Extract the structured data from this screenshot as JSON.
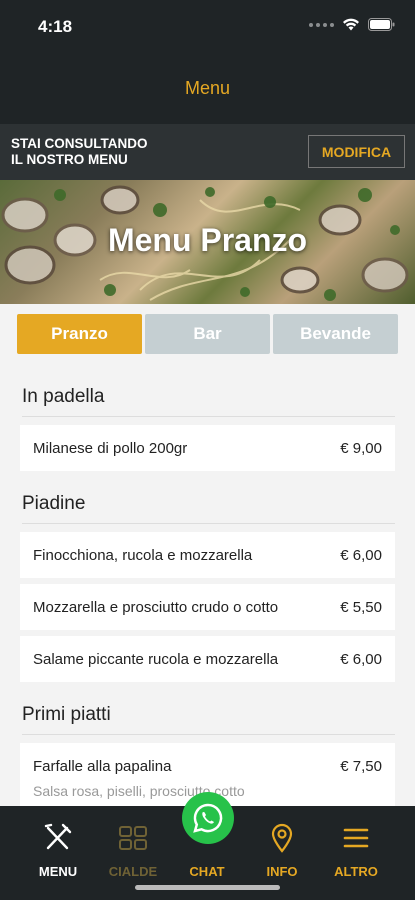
{
  "status": {
    "time": "4:18"
  },
  "nav": {
    "title": "Menu"
  },
  "banner": {
    "line1": "STAI CONSULTANDO",
    "line2": "IL NOSTRO MENU",
    "modify_label": "MODIFICA"
  },
  "hero": {
    "title": "Menu Pranzo"
  },
  "tabs": [
    {
      "label": "Pranzo",
      "active": true
    },
    {
      "label": "Bar",
      "active": false
    },
    {
      "label": "Bevande",
      "active": false
    }
  ],
  "sections": [
    {
      "title": "In padella",
      "items": [
        {
          "name": "Milanese di pollo 200gr",
          "price": "€ 9,00"
        }
      ]
    },
    {
      "title": "Piadine",
      "items": [
        {
          "name": "Finocchiona, rucola e mozzarella",
          "price": "€ 6,00"
        },
        {
          "name": "Mozzarella e prosciutto crudo o cotto",
          "price": "€ 5,50"
        },
        {
          "name": "Salame piccante rucola e mozzarella",
          "price": "€ 6,00"
        }
      ]
    },
    {
      "title": "Primi piatti",
      "items": [
        {
          "name": "Farfalle alla papalina",
          "desc": "Salsa rosa, piselli, prosciutto cotto",
          "price": "€ 7,50"
        }
      ]
    }
  ],
  "tabbar": {
    "menu": "MENU",
    "cialde": "CIALDE",
    "chat": "CHAT",
    "info": "INFO",
    "altro": "ALTRO"
  },
  "colors": {
    "accent": "#e5a823",
    "dark": "#1f2426",
    "inactive_tab": "#c5cfd2",
    "whatsapp": "#27c24a"
  }
}
